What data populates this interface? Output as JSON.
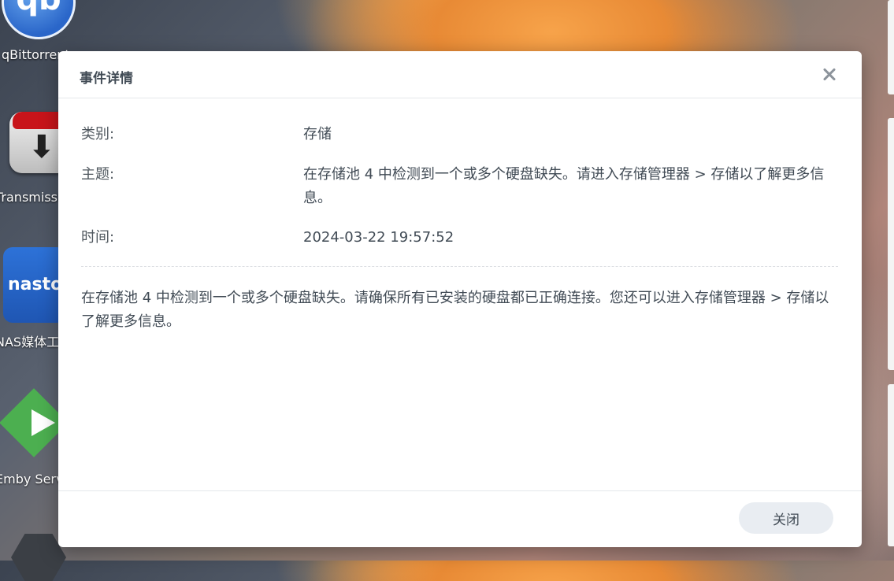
{
  "desktop": {
    "icons": [
      {
        "label": "qBittorrent",
        "glyph": "qb"
      },
      {
        "label": "Transmission",
        "glyph": "download-arrow"
      },
      {
        "label": "NAS媒体工具",
        "glyph": "nastool"
      },
      {
        "label": "Emby Server",
        "glyph": "emby-play"
      }
    ],
    "qb_glyph_text": "qb",
    "nastool_text": "nastool"
  },
  "dialog": {
    "title": "事件详情",
    "close_icon": "close-icon",
    "fields": [
      {
        "label": "类别:",
        "value": "存储"
      },
      {
        "label": "主题:",
        "value": "在存储池 4 中检测到一个或多个硬盘缺失。请进入存储管理器 > 存储以了解更多信息。"
      },
      {
        "label": "时间:",
        "value": "2024-03-22 19:57:52"
      }
    ],
    "description": "在存储池 4 中检测到一个或多个硬盘缺失。请确保所有已安装的硬盘都已正确连接。您还可以进入存储管理器 > 存储以了解更多信息。",
    "footer": {
      "close_button_label": "关闭"
    }
  },
  "colors": {
    "dialog_background": "#ffffff",
    "text_primary": "#414b55",
    "button_background": "#e9edf2",
    "close_icon": "#8c939b"
  }
}
